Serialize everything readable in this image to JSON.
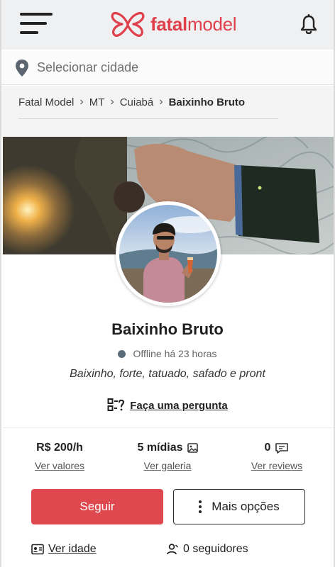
{
  "header": {
    "logo_text_bold": "fatal",
    "logo_text_light": "model",
    "brand_color": "#e0404c"
  },
  "city": {
    "placeholder": "Selecionar cidade"
  },
  "breadcrumb": {
    "items": [
      "Fatal Model",
      "MT",
      "Cuiabá",
      "Baixinho Bruto"
    ]
  },
  "profile": {
    "name": "Baixinho Bruto",
    "status": "Offline há 23 horas",
    "bio": "Baixinho, forte, tatuado, safado e pront",
    "ask_label": "Faça uma pergunta"
  },
  "stats": {
    "price": {
      "value": "R$ 200/h",
      "link": "Ver valores"
    },
    "media": {
      "value": "5 mídias",
      "link": "Ver galeria"
    },
    "reviews": {
      "value": "0",
      "link": "Ver reviews"
    }
  },
  "actions": {
    "follow_label": "Seguir",
    "more_label": "Mais opções",
    "follow_color": "#e0484f"
  },
  "footer": {
    "age_label": "Ver idade",
    "followers_label": "0 seguidores"
  }
}
